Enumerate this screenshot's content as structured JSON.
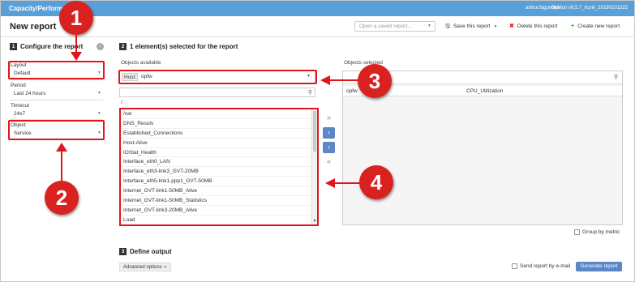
{
  "topbar": {
    "brand": "Capacity/Performance",
    "user": "arthur.fagundes",
    "version": "OpMon v8.5.7_trunk_20190101322"
  },
  "header": {
    "title": "New report",
    "saved_placeholder": "Open a saved report...",
    "save_label": "Save this report",
    "delete_label": "Delete this report",
    "create_label": "Create new report"
  },
  "configure": {
    "step": "1",
    "title": "Configure the report",
    "layout_label": "Layout",
    "layout_value": "Default",
    "period_label": "Period",
    "period_value": "Last 24 hours",
    "timecut_label": "Timecut",
    "timecut_value": "24x7",
    "object_label": "Object",
    "object_value": "Service"
  },
  "selection": {
    "step": "2",
    "title": "1 element(s) selected for the report",
    "available_label": "Objects available",
    "selected_label": "Objects selected",
    "host_label": "Host:",
    "host_value": "opfw",
    "root_path": "/",
    "services": [
      "/var",
      "DNS_Resolv",
      "Established_Connections",
      "Host-Alive",
      "IOStat_Health",
      "Interface_eth0_LAN",
      "Interface_eth3-link3_GVT-20MB",
      "Interface_eth5-link1-ppp1_GVT-50MB",
      "Internet_GVT-link1-50MB_Alive",
      "Internet_GVT-link1-50MB_Statistics",
      "Internet_GVT-link3-20MB_Alive",
      "Load"
    ],
    "selected_items": [
      {
        "host": "opfw",
        "service": "CPU_Utilization"
      }
    ],
    "move_buttons": [
      "»",
      "›",
      "‹",
      "«"
    ],
    "group_by_metric": "Group by metric"
  },
  "output": {
    "step": "3",
    "title": "Define output",
    "advanced_label": "Advanced options",
    "email_label": "Send report by e-mail",
    "generate_label": "Generate report"
  },
  "callouts": [
    "1",
    "2",
    "3",
    "4"
  ],
  "colors": {
    "topbar": "#5aa0d8",
    "highlight": "#e3151c",
    "callout": "#d9211f",
    "button": "#5b86c7"
  }
}
